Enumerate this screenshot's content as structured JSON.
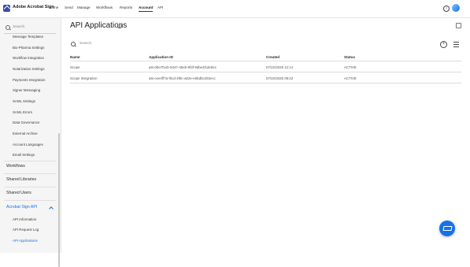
{
  "header": {
    "brand": "Adobe Acrobat Sign",
    "nav": [
      "Home",
      "Send",
      "Manage",
      "Workflows",
      "Reports",
      "Account",
      "API"
    ],
    "active": "Account",
    "help": "?"
  },
  "sidebar": {
    "search_placeholder": "Search",
    "items": [
      "Message Templates",
      "Bio-Pharma Settings",
      "Workflow Integration",
      "Notarization Settings",
      "Payments Integration",
      "Signer Messaging",
      "SAML Settings",
      "SAML Errors",
      "Data Governance",
      "External Archive",
      "Account Languages",
      "Email Settings"
    ],
    "sections": [
      "Workflows",
      "Shared Libraries",
      "Shared Users"
    ],
    "api_section": "Acrobat Sign API",
    "api_items": [
      "API Information",
      "API Request Log",
      "API Applications"
    ]
  },
  "main": {
    "title": "API Applications",
    "search_placeholder": "Search",
    "columns": [
      "Name",
      "Application ID",
      "Created",
      "Status"
    ],
    "rows": [
      {
        "name": "Scope",
        "app_id": "ats-0be7f1eb-5347-45eb-9f3f-9dbe4fcde0ec",
        "created": "07/22/2025 12:14",
        "status": "ACTIVE"
      },
      {
        "name": "Scope Integration",
        "app_id": "ats-cee4ff7a-f0cd-4f8c-a02e-e6bdbc292ecc",
        "created": "07/22/2025 09:22",
        "status": "ACTIVE"
      }
    ]
  },
  "colors": {
    "accent": "#1473e6",
    "brand": "#3b4ba8"
  },
  "icons": {
    "refresh": "refresh-icon",
    "add": "plus-circle-icon",
    "menu": "hamburger-menu-icon",
    "fab": "graduation-cap-icon"
  }
}
